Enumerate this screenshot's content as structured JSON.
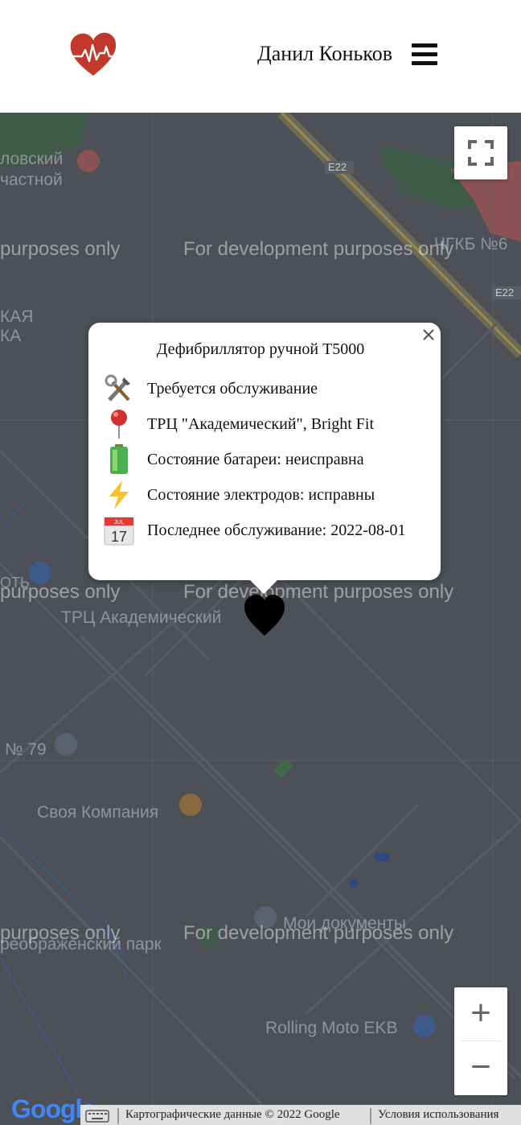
{
  "header": {
    "user_name": "Данил Коньков",
    "logo_icon": "heart-pulse-icon",
    "menu_icon": "hamburger-menu-icon",
    "logo_color": "#c0392b"
  },
  "map": {
    "watermark_text": "For development purposes only",
    "watermark_partial": "purposes only",
    "labels": {
      "hospital_left_1": "ловский",
      "hospital_left_2": "частной",
      "kgb": "ЧГКБ №6",
      "e22_top": "E22",
      "e22_right": "E22",
      "left_kaya": "КАЯ",
      "left_ka": "КА",
      "left_ot": "ОТЬ",
      "trc": "ТРЦ Академический",
      "school": "№ 79",
      "svoya": "Своя Компания",
      "moi_doc": "Мои документы",
      "park": "реображенский парк",
      "rolling": "Rolling Moto EKB"
    },
    "fullscreen_icon": "fullscreen-icon",
    "zoom_in": "+",
    "zoom_out": "−"
  },
  "popup": {
    "title": "Дефибриллятор ручной T5000",
    "rows": [
      {
        "icon": "tools-icon",
        "text": "Требуется обслуживание"
      },
      {
        "icon": "pin-icon",
        "text": "ТРЦ \"Академический\", Bright Fit"
      },
      {
        "icon": "battery-icon",
        "text": "Состояние батареи: неисправна"
      },
      {
        "icon": "lightning-icon",
        "text": "Состояние электродов: исправны"
      },
      {
        "icon": "calendar-icon",
        "text": "Последнее обслуживание: 2022-08-01",
        "calendar_day": "17",
        "calendar_month": "JUL"
      }
    ],
    "close_icon": "close-icon"
  },
  "marker": {
    "icon": "heart-marker-icon",
    "color": "#000000"
  },
  "footer": {
    "google": "Google",
    "map_data": "Картографические данные © 2022 Google",
    "terms": "Условия использования",
    "keyboard_icon": "keyboard-icon"
  }
}
